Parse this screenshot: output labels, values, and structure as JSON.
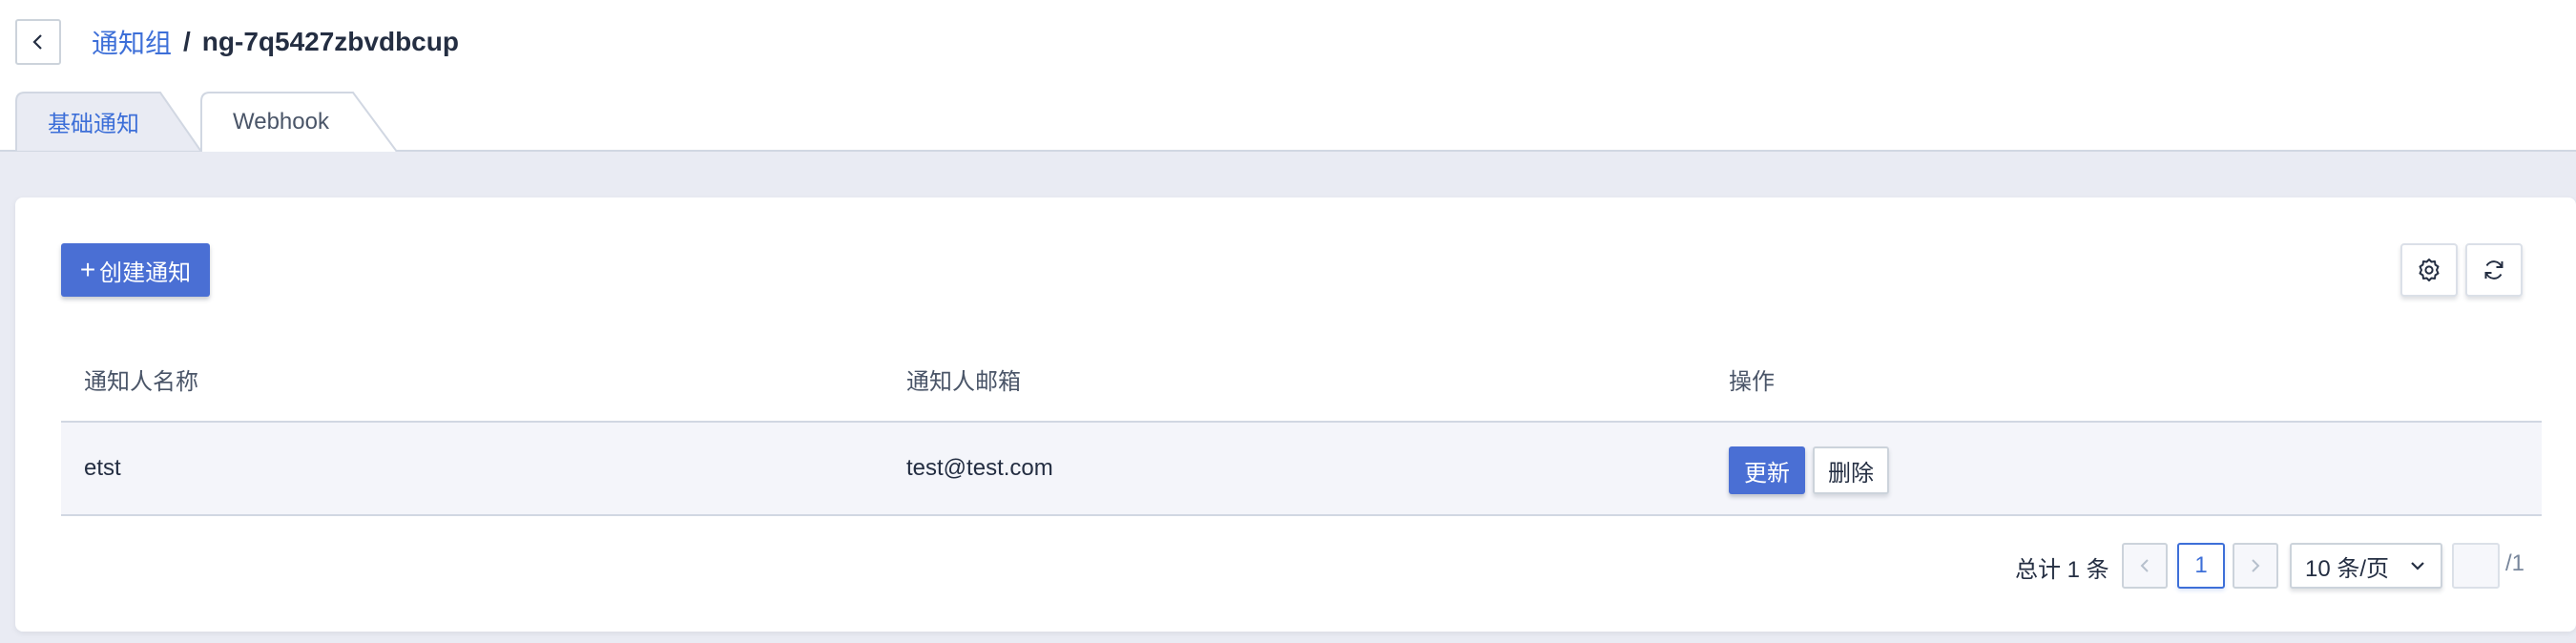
{
  "breadcrumb": {
    "parent": "通知组",
    "separator": "/",
    "current": "ng-7q5427zbvdbcup"
  },
  "tabs": [
    {
      "label": "基础通知",
      "active": true
    },
    {
      "label": "Webhook",
      "active": false
    }
  ],
  "toolbar": {
    "create_label": "创建通知",
    "create_plus": "+"
  },
  "table": {
    "headers": [
      "通知人名称",
      "通知人邮箱",
      "操作"
    ],
    "rows": [
      {
        "name": "etst",
        "email": "test@test.com",
        "update_label": "更新",
        "delete_label": "删除"
      }
    ]
  },
  "pagination": {
    "total_text": "总计 1 条",
    "current_page": "1",
    "page_size": "10 条/页",
    "page_total": "/1"
  },
  "colors": {
    "primary": "#4a6fd4",
    "link": "#3d6fd8",
    "text": "#242e42",
    "background": "#e9ebf3",
    "row_bg": "#f4f5fa"
  },
  "icons": [
    "chevron-left-icon",
    "plus-icon",
    "settings-icon",
    "refresh-icon",
    "chevron-down-icon",
    "chevron-right-icon"
  ]
}
